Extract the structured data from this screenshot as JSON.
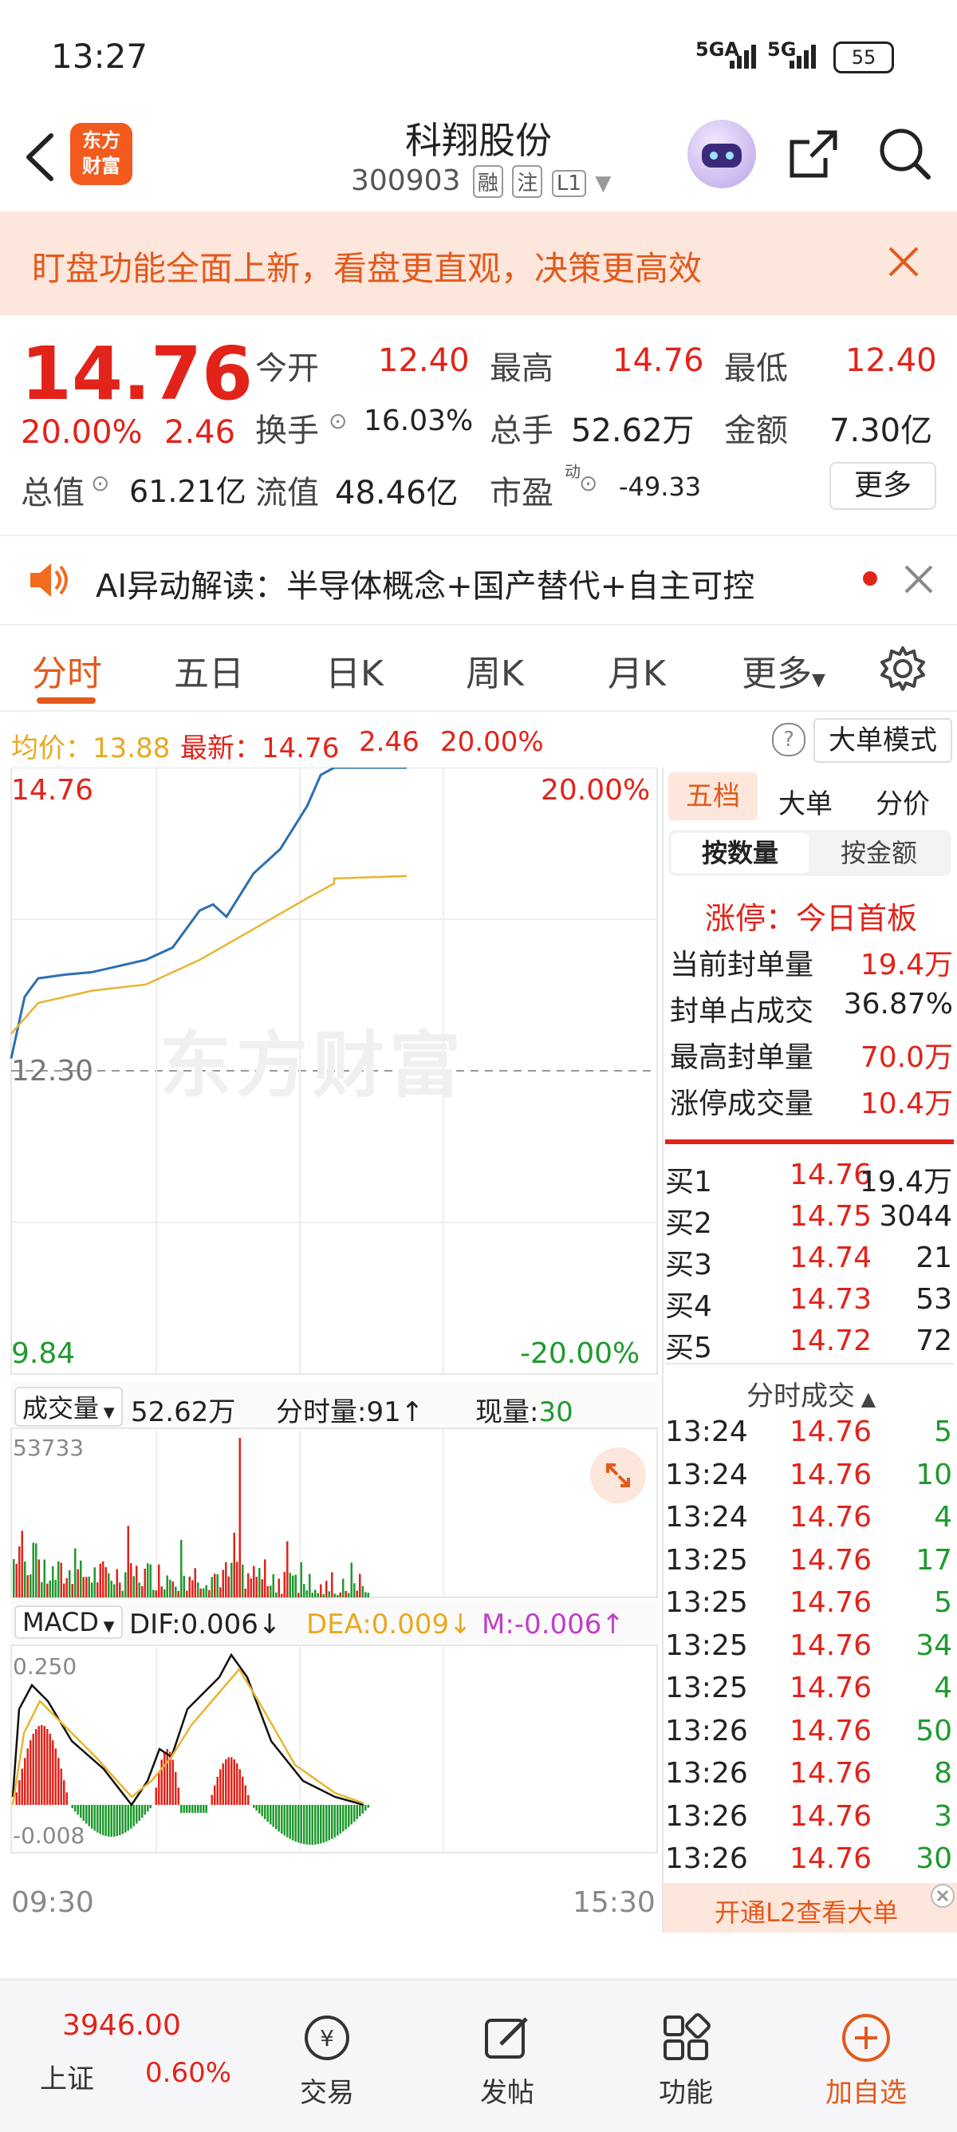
{
  "status": {
    "time": "13:27",
    "network1": "5GA",
    "network2": "5G",
    "battery": "55"
  },
  "header": {
    "title": "科翔股份",
    "code": "300903",
    "badges": [
      "融",
      "注",
      "L1"
    ],
    "logo_line1": "东方",
    "logo_line2": "财富"
  },
  "banner": {
    "text": "盯盘功能全面上新，看盘更直观，决策更高效"
  },
  "quote": {
    "price": "14.76",
    "change_pct": "20.00%",
    "change": "2.46",
    "open_label": "今开",
    "open": "12.40",
    "high_label": "最高",
    "high": "14.76",
    "low_label": "最低",
    "low": "12.40",
    "turnover_label": "换手",
    "turnover": "16.03%",
    "volume_label": "总手",
    "volume": "52.62万",
    "amount_label": "金额",
    "amount": "7.30亿",
    "mktcap_label": "总值",
    "mktcap": "61.21亿",
    "float_label": "流值",
    "float_cap": "48.46亿",
    "pe_label": "市盈",
    "pe_sup": "动",
    "pe": "-49.33",
    "more_label": "更多"
  },
  "ai": {
    "text": "AI异动解读：半导体概念+国产替代+自主可控"
  },
  "tabs": [
    "分时",
    "五日",
    "日K",
    "周K",
    "月K",
    "更多"
  ],
  "infobar": {
    "avg_label": "均价：13.88",
    "latest_label": "最新：14.76",
    "change": "2.46",
    "pct": "20.00%",
    "mode_button": "大单模式"
  },
  "chart": {
    "top_price": "14.76",
    "top_pct": "20.00%",
    "mid_label": "12.30",
    "bottom_price": "9.84",
    "bottom_pct": "-20.00%",
    "watermark": "东方财富",
    "vol_selector": "成交量",
    "vol_total": "52.62万",
    "tick_vol_label": "分时量:",
    "tick_vol": "91",
    "cur_vol_label": "现量:",
    "cur_vol": "30",
    "vol_max": "53733",
    "macd_selector": "MACD",
    "dif": "DIF:0.006",
    "dea": "DEA:0.009",
    "m": "M:-0.006",
    "macd_top": "0.250",
    "macd_bottom": "-0.008",
    "time_start": "09:30",
    "time_end": "15:30"
  },
  "chart_data": {
    "type": "line",
    "xlabel": "",
    "ylabel": "",
    "x_range": [
      "09:30",
      "15:30"
    ],
    "ylim": [
      9.84,
      14.76
    ],
    "series": [
      {
        "name": "",
        "color": "#2b6fb3",
        "x": [
          "09:30",
          "09:35",
          "09:40",
          "09:50",
          "10:00",
          "10:10",
          "10:20",
          "10:30",
          "10:40",
          "10:45",
          "10:50",
          "11:00",
          "11:10",
          "11:20",
          "11:25",
          "11:30",
          "13:00",
          "13:27"
        ],
        "values": [
          12.4,
          12.9,
          13.05,
          13.08,
          13.1,
          13.15,
          13.2,
          13.3,
          13.6,
          13.65,
          13.55,
          13.9,
          14.1,
          14.45,
          14.7,
          14.76,
          14.76,
          14.76
        ]
      },
      {
        "name": "",
        "color": "#e8b531",
        "x": [
          "09:30",
          "09:40",
          "10:00",
          "10:20",
          "10:40",
          "11:00",
          "11:20",
          "11:30",
          "13:00",
          "13:27"
        ],
        "values": [
          12.6,
          12.85,
          12.95,
          13.0,
          13.2,
          13.45,
          13.7,
          13.82,
          13.86,
          13.88
        ]
      }
    ]
  },
  "panel": {
    "tabs": [
      "五档",
      "大单",
      "分价"
    ],
    "subtabs": [
      "按数量",
      "按金额"
    ],
    "limit_title": "涨停：今日首板",
    "stats": [
      {
        "label": "当前封单量",
        "value": "19.4万"
      },
      {
        "label": "封单占成交",
        "value": "36.87%"
      },
      {
        "label": "最高封单量",
        "value": "70.0万"
      },
      {
        "label": "涨停成交量",
        "value": "10.4万"
      }
    ],
    "bids": [
      {
        "label": "买1",
        "price": "14.76",
        "vol": "19.4万"
      },
      {
        "label": "买2",
        "price": "14.75",
        "vol": "3044"
      },
      {
        "label": "买3",
        "price": "14.74",
        "vol": "21"
      },
      {
        "label": "买4",
        "price": "14.73",
        "vol": "53"
      },
      {
        "label": "买5",
        "price": "14.72",
        "vol": "72"
      }
    ],
    "trades_title": "分时成交",
    "trades": [
      {
        "time": "13:24",
        "price": "14.76",
        "vol": "5"
      },
      {
        "time": "13:24",
        "price": "14.76",
        "vol": "10"
      },
      {
        "time": "13:24",
        "price": "14.76",
        "vol": "4"
      },
      {
        "time": "13:25",
        "price": "14.76",
        "vol": "17"
      },
      {
        "time": "13:25",
        "price": "14.76",
        "vol": "5"
      },
      {
        "time": "13:25",
        "price": "14.76",
        "vol": "34"
      },
      {
        "time": "13:25",
        "price": "14.76",
        "vol": "4"
      },
      {
        "time": "13:26",
        "price": "14.76",
        "vol": "50"
      },
      {
        "time": "13:26",
        "price": "14.76",
        "vol": "8"
      },
      {
        "time": "13:26",
        "price": "14.76",
        "vol": "3"
      },
      {
        "time": "13:26",
        "price": "14.76",
        "vol": "30"
      }
    ],
    "l2_text": "开通L2查看大单"
  },
  "bottomnav": {
    "index_value": "3946.00",
    "index_name": "上证",
    "index_pct": "0.60%",
    "items": [
      {
        "label": "交易",
        "icon": "trade-icon"
      },
      {
        "label": "发帖",
        "icon": "post-icon"
      },
      {
        "label": "功能",
        "icon": "function-icon"
      },
      {
        "label": "加自选",
        "icon": "add-watchlist-icon"
      }
    ]
  }
}
